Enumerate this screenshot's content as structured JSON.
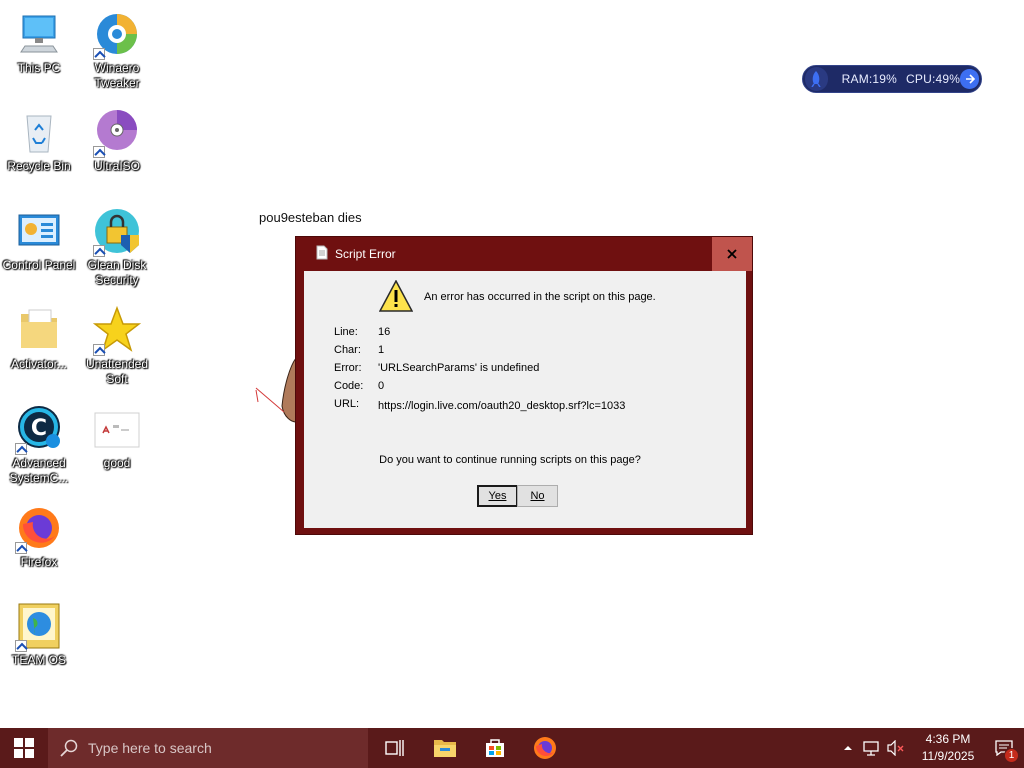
{
  "desktop": {
    "icons": [
      {
        "label": "This PC"
      },
      {
        "label": "Winaero Tweaker"
      },
      {
        "label": "Recycle Bin"
      },
      {
        "label": "UltraISO"
      },
      {
        "label": "Control Panel"
      },
      {
        "label": "Glean Disk Security"
      },
      {
        "label": "Activator..."
      },
      {
        "label": "Unattended Soft"
      },
      {
        "label": "Advanced SystemC..."
      },
      {
        "label": "good"
      },
      {
        "label": "Firefox"
      },
      {
        "label": "TEAM OS"
      }
    ],
    "overlay_text": "pou9esteban dies"
  },
  "widget": {
    "ram": "RAM:19%",
    "cpu": "CPU:49%"
  },
  "dialog": {
    "title": "Script Error",
    "message": "An error has occurred in the script on this page.",
    "fields": [
      {
        "key": "Line:",
        "value": "16"
      },
      {
        "key": "Char:",
        "value": "1"
      },
      {
        "key": "Error:",
        "value": "'URLSearchParams' is undefined"
      },
      {
        "key": "Code:",
        "value": "0"
      },
      {
        "key": "URL:",
        "value": "https://login.live.com/oauth20_desktop.srf?lc=1033"
      }
    ],
    "question": "Do you want to continue running scripts on this page?",
    "yes_label": "Yes",
    "no_label": "No"
  },
  "taskbar": {
    "search_placeholder": "Type here to search",
    "time": "4:36 PM",
    "date": "11/9/2025",
    "notification_count": "1"
  },
  "colors": {
    "taskbar": "#5a1a1a",
    "dialog_frame": "#6f1010",
    "close_button": "#c0544d"
  }
}
